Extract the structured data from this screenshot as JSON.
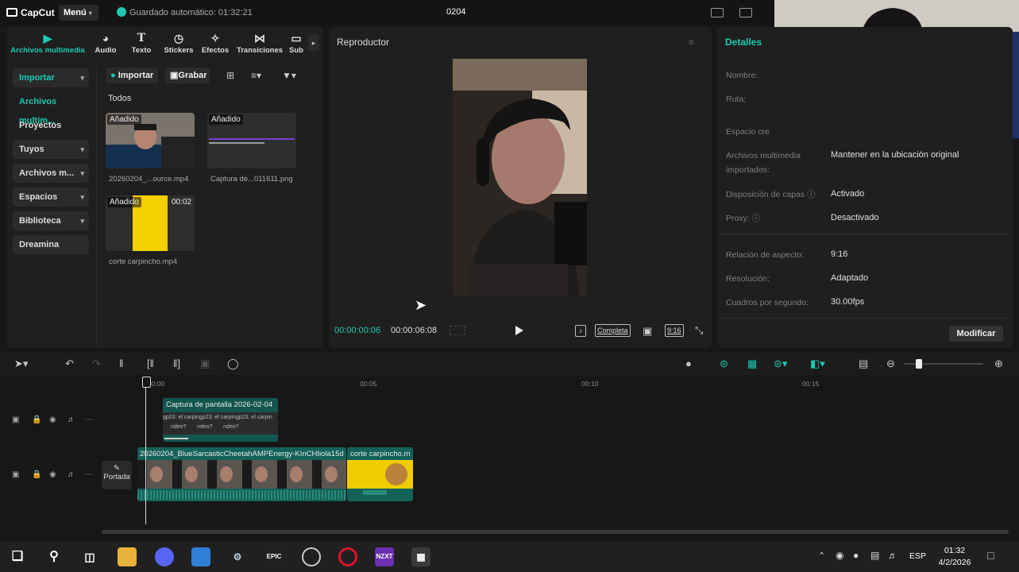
{
  "app": {
    "name": "CapCut",
    "menu_label": "Menú",
    "autosave": "Guardado automático: 01:32:21",
    "project_title": "0204"
  },
  "media_tabs": [
    {
      "label": "Archivos multimedia",
      "icon": "media-icon"
    },
    {
      "label": "Audio",
      "icon": "audio-icon"
    },
    {
      "label": "Texto",
      "icon": "text-icon"
    },
    {
      "label": "Stickers",
      "icon": "stickers-icon"
    },
    {
      "label": "Efectos",
      "icon": "effects-icon"
    },
    {
      "label": "Transiciones",
      "icon": "transitions-icon"
    },
    {
      "label": "Sub",
      "icon": "subtitles-icon"
    }
  ],
  "sidebar": {
    "items": [
      {
        "label": "Importar"
      },
      {
        "label": "Archivos multim..."
      },
      {
        "label": "Proyectos secun..."
      },
      {
        "label": "Tuyos"
      },
      {
        "label": "Archivos m..."
      },
      {
        "label": "Espacios"
      },
      {
        "label": "Biblioteca"
      },
      {
        "label": "Dreamina"
      }
    ]
  },
  "media_toolbar": {
    "import_label": "Importar",
    "record_label": "Grabar"
  },
  "media": {
    "section": "Todos",
    "items": [
      {
        "badge": "Añadido",
        "name": "20260204_...ource.mp4",
        "duration": ""
      },
      {
        "badge": "Añadido",
        "name": "Captura de...011611.png",
        "duration": ""
      },
      {
        "badge": "Añadido",
        "name": "corte carpincho.mp4",
        "duration": "00:02"
      }
    ]
  },
  "player": {
    "title": "Reproductor",
    "current_time": "00:00:00:06",
    "total_time": "00:00:06:08",
    "full_label": "Completa",
    "ratio_label": "9:16"
  },
  "details": {
    "title": "Detalles",
    "rows": [
      {
        "label": "Nombre:",
        "value": ""
      },
      {
        "label": "Ruta:",
        "value": ""
      },
      {
        "label": "Espacio cre",
        "value": ""
      },
      {
        "label": "Archivos multimedia importados:",
        "value": "Mantener en la ubicación original"
      },
      {
        "label": "Disposición de capas",
        "value": "Activado"
      },
      {
        "label": "Proxy:",
        "value": "Desactivado"
      },
      {
        "label": "Relación de aspecto:",
        "value": "9:16"
      },
      {
        "label": "Resolución:",
        "value": "Adaptado"
      },
      {
        "label": "Cuadros por segundo:",
        "value": "30.00fps"
      }
    ],
    "modify_label": "Modificar"
  },
  "timeline": {
    "ruler": [
      "00:00",
      "00:05",
      "00:10",
      "00:15"
    ],
    "clips": {
      "capture": "Captura de pantalla 2026-02-04",
      "main": "20260204_BlueSarcasticCheetahAMPEnergy-KInCHIiola15d",
      "corte": "corte carpincho.m"
    },
    "capture_text": "gp23: el carpingp23: el carpingp23: el carpin",
    "capture_text2": "ndeo?       ndeo?       ndeo?",
    "cover_label": "Portada"
  },
  "taskbar": {
    "apps": [
      "Start",
      "Search",
      "Task View",
      "Explorer",
      "Discord",
      "Store",
      "Steam",
      "Epic Games",
      "OBS",
      "Opera",
      "NZXT",
      "CapCut"
    ],
    "lang": "ESP",
    "time": "01:32",
    "date": "4/2/2026"
  },
  "colors": {
    "accent": "#1ec8b4",
    "bg": "#171717",
    "panel": "#1f1f1f",
    "clip": "#136158"
  }
}
